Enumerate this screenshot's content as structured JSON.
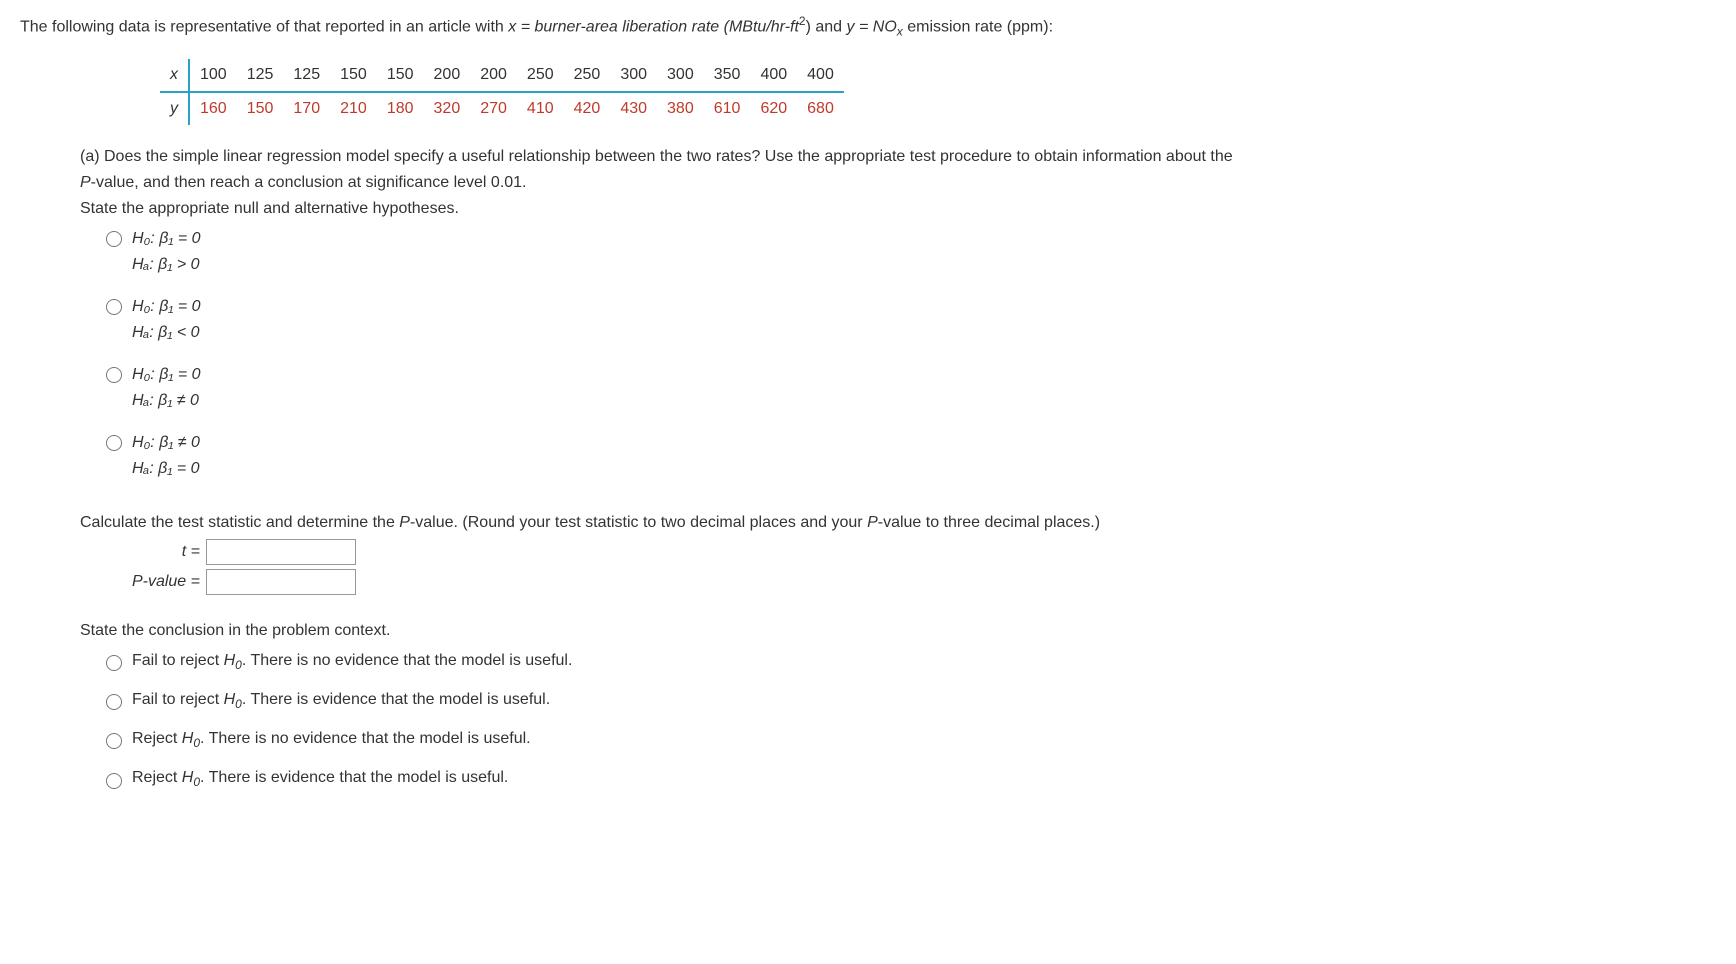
{
  "intro": {
    "prefix": "The following data is representative of that reported in an article with ",
    "x_eq": "x = burner-area liberation rate (MBtu/hr-ft",
    "sq": "2",
    "x_close": ") and ",
    "y_eq": "y = NO",
    "nox_sub": "x",
    "y_close": " emission rate (ppm):"
  },
  "table": {
    "x_label": "x",
    "y_label": "y",
    "x_values": [
      "100",
      "125",
      "125",
      "150",
      "150",
      "200",
      "200",
      "250",
      "250",
      "300",
      "300",
      "350",
      "400",
      "400"
    ],
    "y_values": [
      "160",
      "150",
      "170",
      "210",
      "180",
      "320",
      "270",
      "410",
      "420",
      "430",
      "380",
      "610",
      "620",
      "680"
    ]
  },
  "part_a": {
    "q1": "(a) Does the simple linear regression model specify a useful relationship between the two rates? Use the appropriate test procedure to obtain information about the",
    "q2": "P-value, and then reach a conclusion at significance level 0.01.",
    "state": "State the appropriate null and alternative hypotheses."
  },
  "hypotheses": [
    {
      "h0": "H₀: β₁ = 0",
      "ha": "Hₐ: β₁ > 0"
    },
    {
      "h0": "H₀: β₁ = 0",
      "ha": "Hₐ: β₁ < 0"
    },
    {
      "h0": "H₀: β₁ = 0",
      "ha": "Hₐ: β₁ ≠ 0"
    },
    {
      "h0": "H₀: β₁ ≠ 0",
      "ha": "Hₐ: β₁ = 0"
    }
  ],
  "calc": {
    "prompt": "Calculate the test statistic and determine the P-value. (Round your test statistic to two decimal places and your P-value to three decimal places.)",
    "t_label": "t =",
    "p_label": "P-value ="
  },
  "conclusion": {
    "prompt": "State the conclusion in the problem context.",
    "options": [
      "Fail to reject H₀. There is no evidence that the model is useful.",
      "Fail to reject H₀. There is evidence that the model is useful.",
      "Reject H₀. There is no evidence that the model is useful.",
      "Reject H₀. There is evidence that the model is useful."
    ]
  }
}
